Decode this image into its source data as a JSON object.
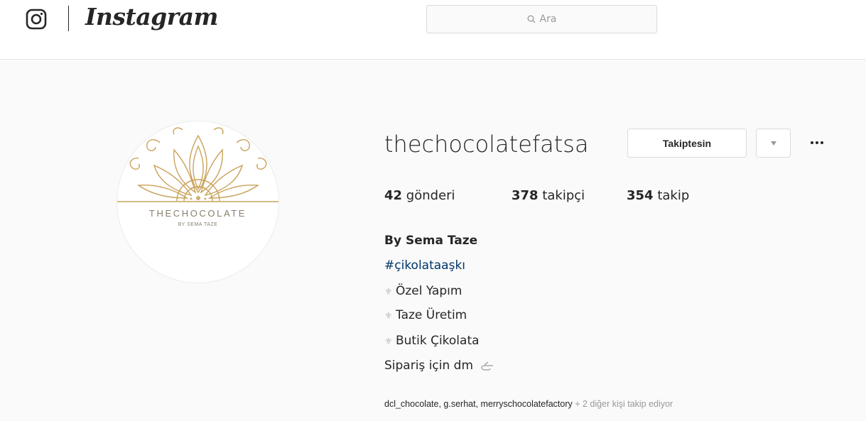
{
  "header": {
    "wordmark": "Instagram",
    "search": {
      "placeholder": "Ara"
    }
  },
  "profile": {
    "avatar_text": "THECHOCOLATE",
    "avatar_subtext": "BY SEMA TAZE",
    "username": "thechocolatefatsa",
    "follow_button": "Takiptesin",
    "more_icon": "more-dots-icon",
    "stats": {
      "posts_count": "42",
      "posts_label": "gönderi",
      "followers_count": "378",
      "followers_label": "takipçi",
      "following_count": "354",
      "following_label": "takip"
    },
    "bio": {
      "name": "By Sema Taze",
      "hashtag": "#çikolataaşkı",
      "line1": "Özel Yapım",
      "line2": "Taze Üretim",
      "line3": "Butik Çikolata",
      "line4": "Sipariş için dm"
    },
    "followed_by": {
      "user1": "dcl_chocolate",
      "user2": "g.serhat",
      "user3": "merryschocolatefactory",
      "more": "+ 2 diğer kişi takip ediyor"
    }
  },
  "colors": {
    "gold": "#c9a25a",
    "link": "#003569",
    "border": "#dbdbdb"
  }
}
